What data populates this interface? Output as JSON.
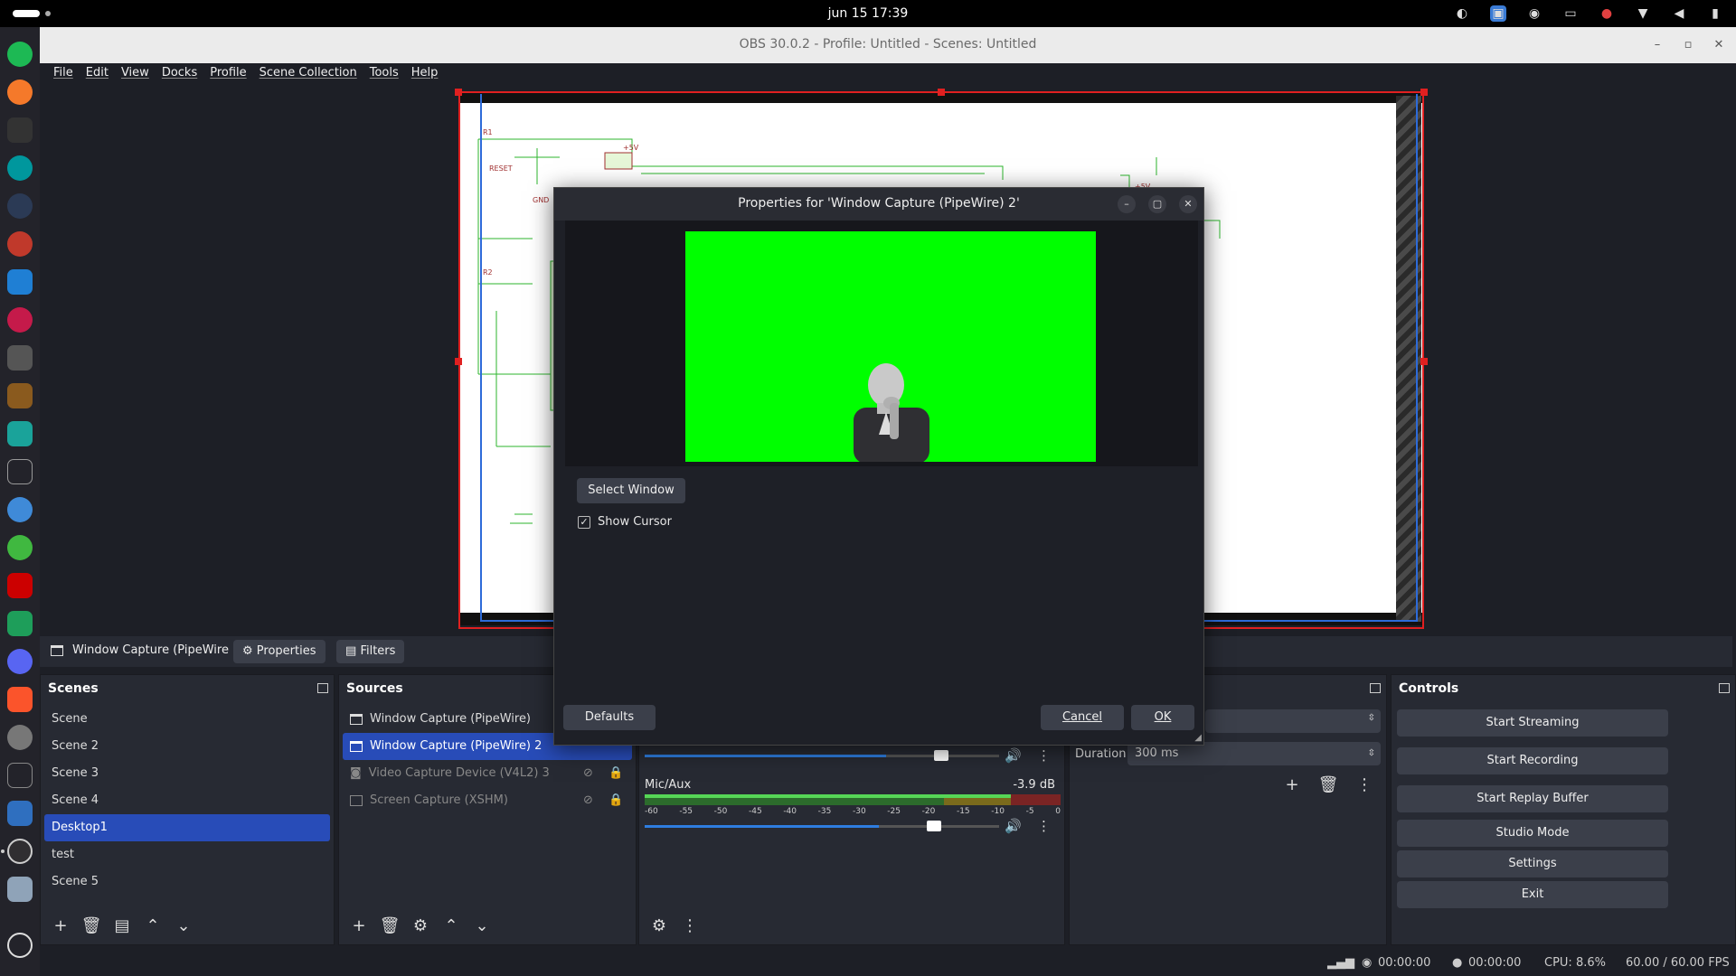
{
  "topbar": {
    "clock": "jun 15  17:39"
  },
  "window": {
    "title": "OBS 30.0.2 - Profile: Untitled - Scenes: Untitled"
  },
  "menu": [
    "File",
    "Edit",
    "View",
    "Docks",
    "Profile",
    "Scene Collection",
    "Tools",
    "Help"
  ],
  "source_toolbar": {
    "source_name": "Window Capture (PipeWire",
    "properties": "Properties",
    "filters": "Filters"
  },
  "scenes": {
    "title": "Scenes",
    "items": [
      "Scene",
      "Scene 2",
      "Scene 3",
      "Scene 4",
      "Desktop1",
      "test",
      "Scene 5"
    ],
    "selected": "Desktop1"
  },
  "sources": {
    "title": "Sources",
    "items": [
      "Window Capture (PipeWire)",
      "Window Capture (PipeWire) 2",
      "Video Capture Device (V4L2) 3",
      "Screen Capture (XSHM)"
    ]
  },
  "mixer": {
    "channel": "Mic/Aux",
    "db": "-3.9 dB",
    "scale": [
      "-60",
      "-55",
      "-50",
      "-45",
      "-40",
      "-35",
      "-30",
      "-25",
      "-20",
      "-15",
      "-10",
      "-5",
      "0"
    ],
    "level": 0.88
  },
  "transitions": {
    "duration_label": "Duration",
    "duration_value": "300 ms"
  },
  "controls": {
    "title": "Controls",
    "buttons": [
      "Start Streaming",
      "Start Recording",
      "Start Replay Buffer",
      "Studio Mode",
      "Settings",
      "Exit"
    ]
  },
  "status": {
    "stream_time": "00:00:00",
    "rec_time": "00:00:00",
    "cpu": "CPU: 8.6%",
    "fps": "60.00 / 60.00 FPS"
  },
  "dialog": {
    "title": "Properties for 'Window Capture (PipeWire) 2'",
    "select_window": "Select Window",
    "show_cursor": "Show Cursor",
    "defaults": "Defaults",
    "cancel": "Cancel",
    "ok": "OK"
  },
  "colors": {
    "accent": "#284cb8",
    "chroma": "#00ff00",
    "selection_red": "#e02020"
  }
}
